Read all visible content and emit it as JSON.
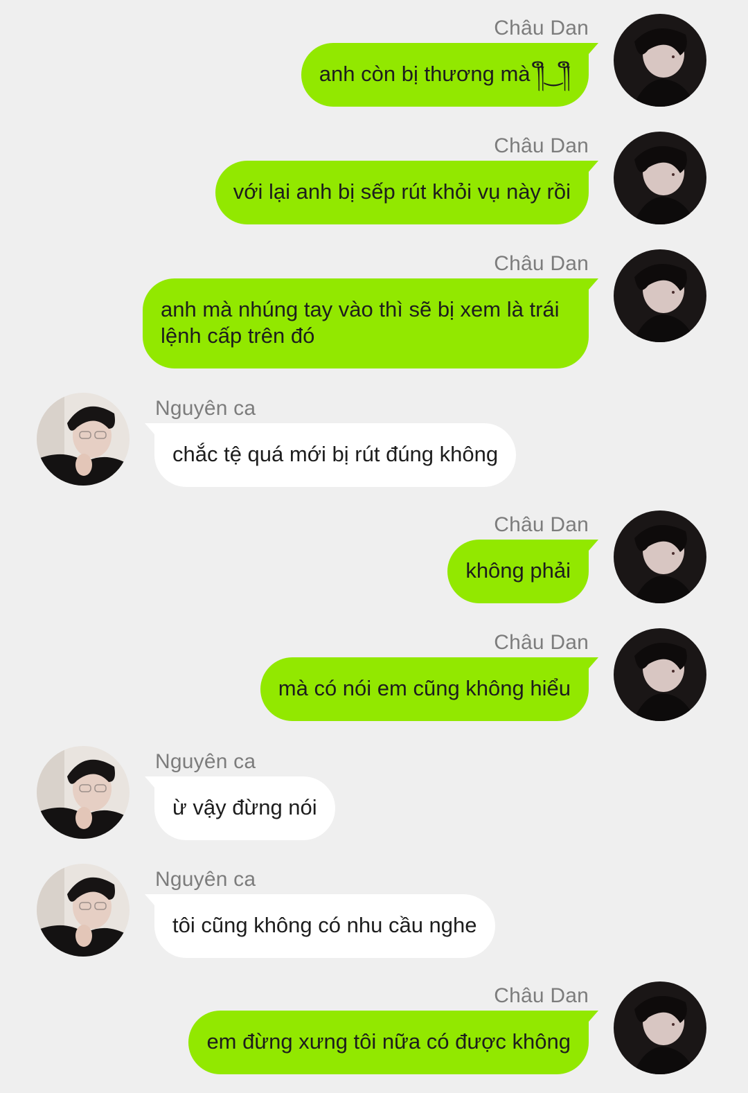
{
  "messages": [
    {
      "sender": "Châu Dan",
      "side": "right",
      "avatar": "chau-dan-avatar",
      "text": "anh còn bị thương mà ༎ຶ‿༎ຶ"
    },
    {
      "sender": "Châu Dan",
      "side": "right",
      "avatar": "chau-dan-avatar",
      "text": "với lại anh bị sếp rút khỏi vụ này rồi"
    },
    {
      "sender": "Châu Dan",
      "side": "right",
      "avatar": "chau-dan-avatar",
      "text": "anh mà nhúng tay vào thì sẽ bị xem là trái lệnh cấp trên đó"
    },
    {
      "sender": "Nguyên ca",
      "side": "left",
      "avatar": "nguyen-ca-avatar",
      "text": "chắc tệ quá mới bị rút đúng không"
    },
    {
      "sender": "Châu Dan",
      "side": "right",
      "avatar": "chau-dan-avatar",
      "text": "không phải"
    },
    {
      "sender": "Châu Dan",
      "side": "right",
      "avatar": "chau-dan-avatar",
      "text": "mà có nói em cũng không hiểu"
    },
    {
      "sender": "Nguyên ca",
      "side": "left",
      "avatar": "nguyen-ca-avatar",
      "text": "ừ vậy đừng nói"
    },
    {
      "sender": "Nguyên ca",
      "side": "left",
      "avatar": "nguyen-ca-avatar",
      "text": "tôi cũng không có nhu cầu nghe"
    },
    {
      "sender": "Châu Dan",
      "side": "right",
      "avatar": "chau-dan-avatar",
      "text": "em đừng xưng tôi nữa có được không"
    }
  ],
  "colors": {
    "background": "#efefef",
    "outgoing_bubble": "#92e800",
    "incoming_bubble": "#ffffff",
    "name_text": "#7c7c7c"
  }
}
